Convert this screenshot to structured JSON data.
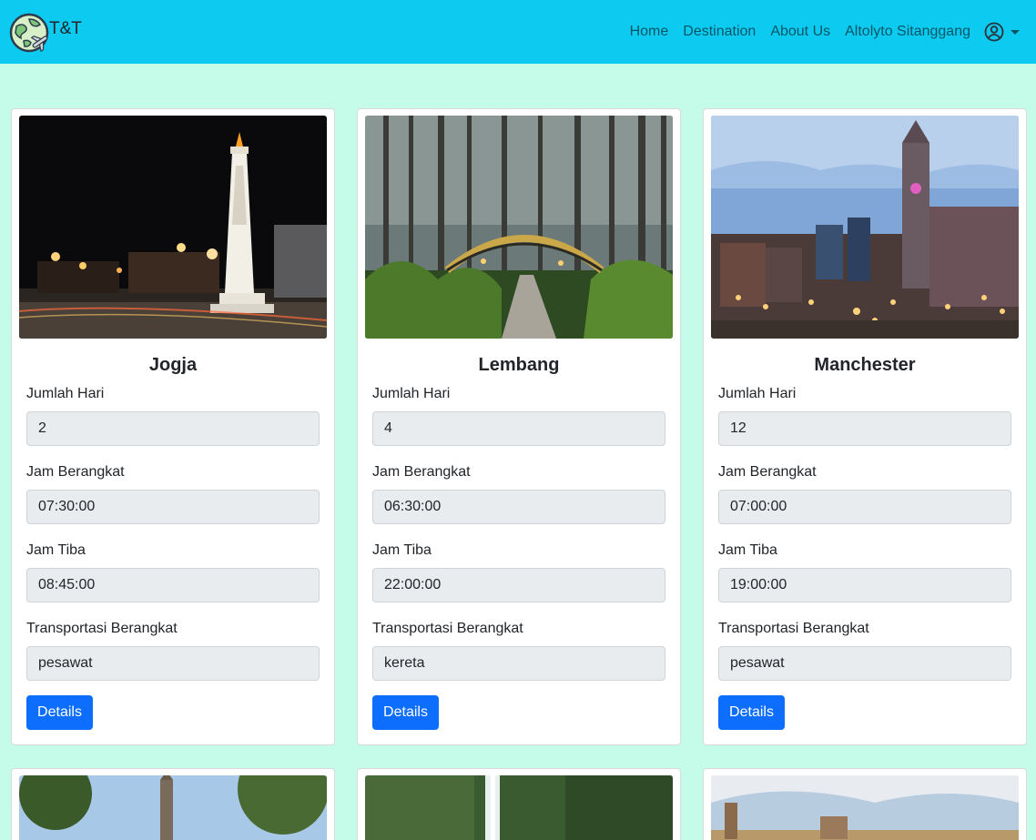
{
  "navbar": {
    "brand": "T&T",
    "links": [
      "Home",
      "Destination",
      "About Us",
      "Altolyto Sitanggang"
    ]
  },
  "labels": {
    "days": "Jumlah Hari",
    "depart": "Jam Berangkat",
    "arrive": "Jam Tiba",
    "transport": "Transportasi Berangkat",
    "details_button": "Details"
  },
  "cards": [
    {
      "title": "Jogja",
      "days": "2",
      "depart": "07:30:00",
      "arrive": "08:45:00",
      "transport": "pesawat"
    },
    {
      "title": "Lembang",
      "days": "4",
      "depart": "06:30:00",
      "arrive": "22:00:00",
      "transport": "kereta"
    },
    {
      "title": "Manchester",
      "days": "12",
      "depart": "07:00:00",
      "arrive": "19:00:00",
      "transport": "pesawat"
    }
  ],
  "colors": {
    "navbar": "#0dcaf0",
    "page_background": "#c5fbe9",
    "button": "#0d6efd"
  }
}
